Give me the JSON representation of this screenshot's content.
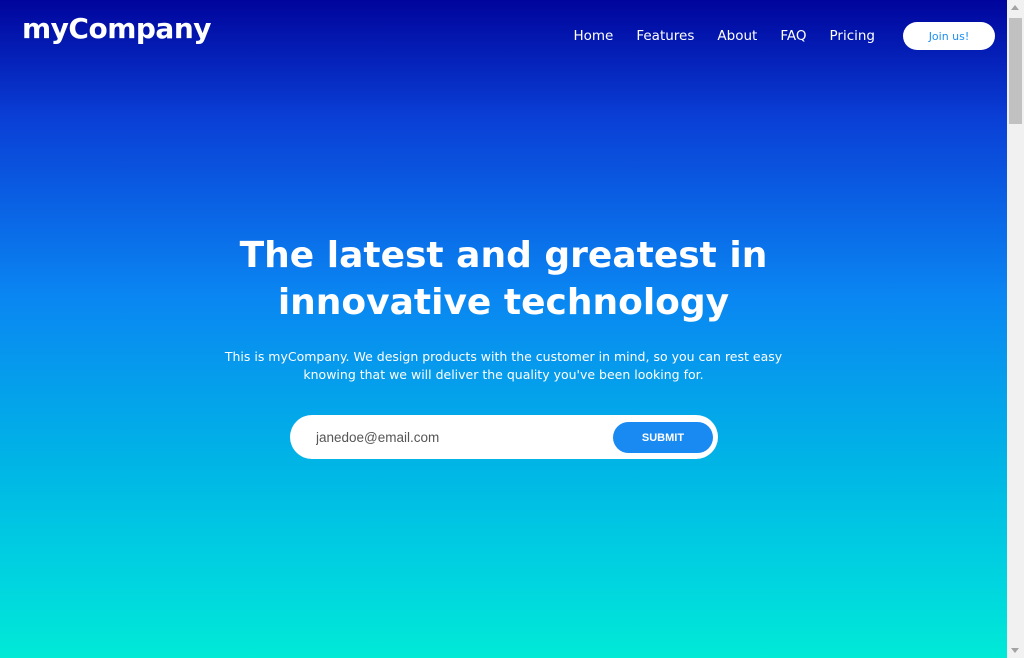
{
  "brand": {
    "logo": "myCompany"
  },
  "nav": {
    "items": [
      {
        "label": "Home"
      },
      {
        "label": "Features"
      },
      {
        "label": "About"
      },
      {
        "label": "FAQ"
      },
      {
        "label": "Pricing"
      }
    ],
    "join_label": "Join us!"
  },
  "hero": {
    "title_line1": "The latest and greatest in",
    "title_line2": "innovative technology",
    "subtitle_line1": "This is myCompany. We design products with the customer in mind, so you can rest easy",
    "subtitle_line2": "knowing that we will deliver the quality you've been looking for."
  },
  "signup": {
    "placeholder": "janedoe@email.com",
    "value": "",
    "submit_label": "SUBMIT"
  },
  "colors": {
    "gradient_top": "#00049c",
    "gradient_mid": "#0a86f2",
    "gradient_bottom": "#00ead6",
    "accent": "#1a8af3",
    "text": "#ffffff"
  },
  "icons": {
    "scroll_up": "chevron-up-icon",
    "scroll_down": "chevron-down-icon"
  }
}
